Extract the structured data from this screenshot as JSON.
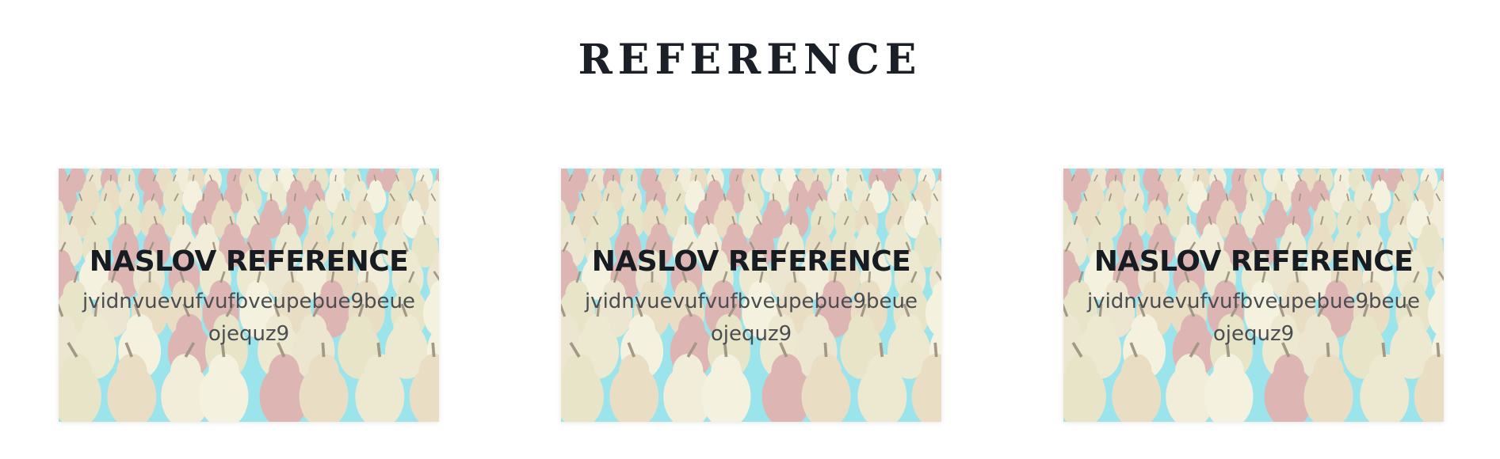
{
  "section": {
    "title": "REFERENCE"
  },
  "cards": [
    {
      "title": "NASLOV REFERENCE",
      "text_line1": "jvidnvuevufvufbveupebue9beue",
      "text_line2": "ojequz9",
      "image": "pears-photo"
    },
    {
      "title": "NASLOV REFERENCE",
      "text_line1": "jvidnvuevufvufbveupebue9beue",
      "text_line2": "ojequz9",
      "image": "pears-photo"
    },
    {
      "title": "NASLOV REFERENCE",
      "text_line1": "jvidnvuevufvufbveupebue9beue",
      "text_line2": "ojequz9",
      "image": "pears-photo"
    }
  ],
  "colors": {
    "title": "#1b1f27",
    "card_title": "#171b22",
    "card_text": "#4a4d52",
    "pear_yellow": "#e3dcb4",
    "pear_red": "#c98a86",
    "tray_blue": "#5fd3df"
  }
}
